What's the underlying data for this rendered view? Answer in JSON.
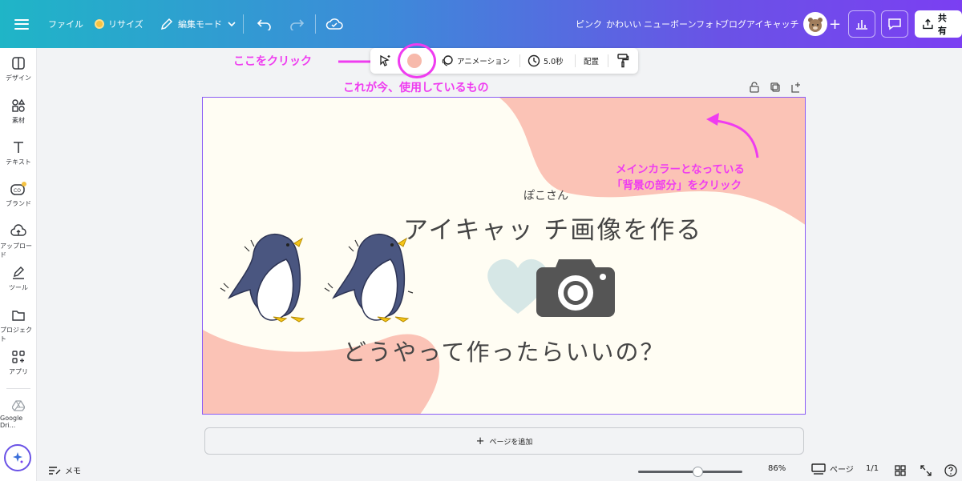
{
  "topbar": {
    "file_label": "ファイル",
    "resize_label": "リサイズ",
    "edit_mode_label": "編集モード",
    "tags": [
      "ピンク",
      "かわいい",
      "ニューボーンフォト",
      "ブログアイキャッチ"
    ],
    "share_label": "共有"
  },
  "sidebar": {
    "items": [
      {
        "label": "デザイン",
        "icon": "layout-icon"
      },
      {
        "label": "素材",
        "icon": "shapes-icon"
      },
      {
        "label": "テキスト",
        "icon": "text-icon"
      },
      {
        "label": "ブランド",
        "icon": "brand-icon"
      },
      {
        "label": "アップロード",
        "icon": "upload-icon"
      },
      {
        "label": "ツール",
        "icon": "pen-icon"
      },
      {
        "label": "プロジェクト",
        "icon": "folder-icon"
      },
      {
        "label": "アプリ",
        "icon": "apps-icon"
      },
      {
        "label": "Google Dri...",
        "icon": "google-drive-icon"
      }
    ]
  },
  "floating_toolbar": {
    "swatch_color": "#f7b9ab",
    "animation_label": "アニメーション",
    "duration_label": "5.0秒",
    "arrange_label": "配置"
  },
  "annotations": {
    "click_here": "ここをクリック",
    "currently_used": "これが今、使用しているもの",
    "main_color_line1": "メインカラーとなっている",
    "main_color_line2": "「背景の部分」をクリック",
    "accent_color": "#ef3cf0"
  },
  "canvas": {
    "author": "ぽこさん",
    "title": "アイキャッ チ画像を作る",
    "subtitle": "どうやって作ったらいいの？",
    "bg_color": "#fffdf3",
    "blob_color": "#fbc3b6"
  },
  "add_page_label": "ページを追加",
  "bottombar": {
    "memo_label": "メモ",
    "zoom_value": "86%",
    "zoom_fraction": 0.57,
    "page_label": "ページ",
    "page_count": "1/1"
  }
}
